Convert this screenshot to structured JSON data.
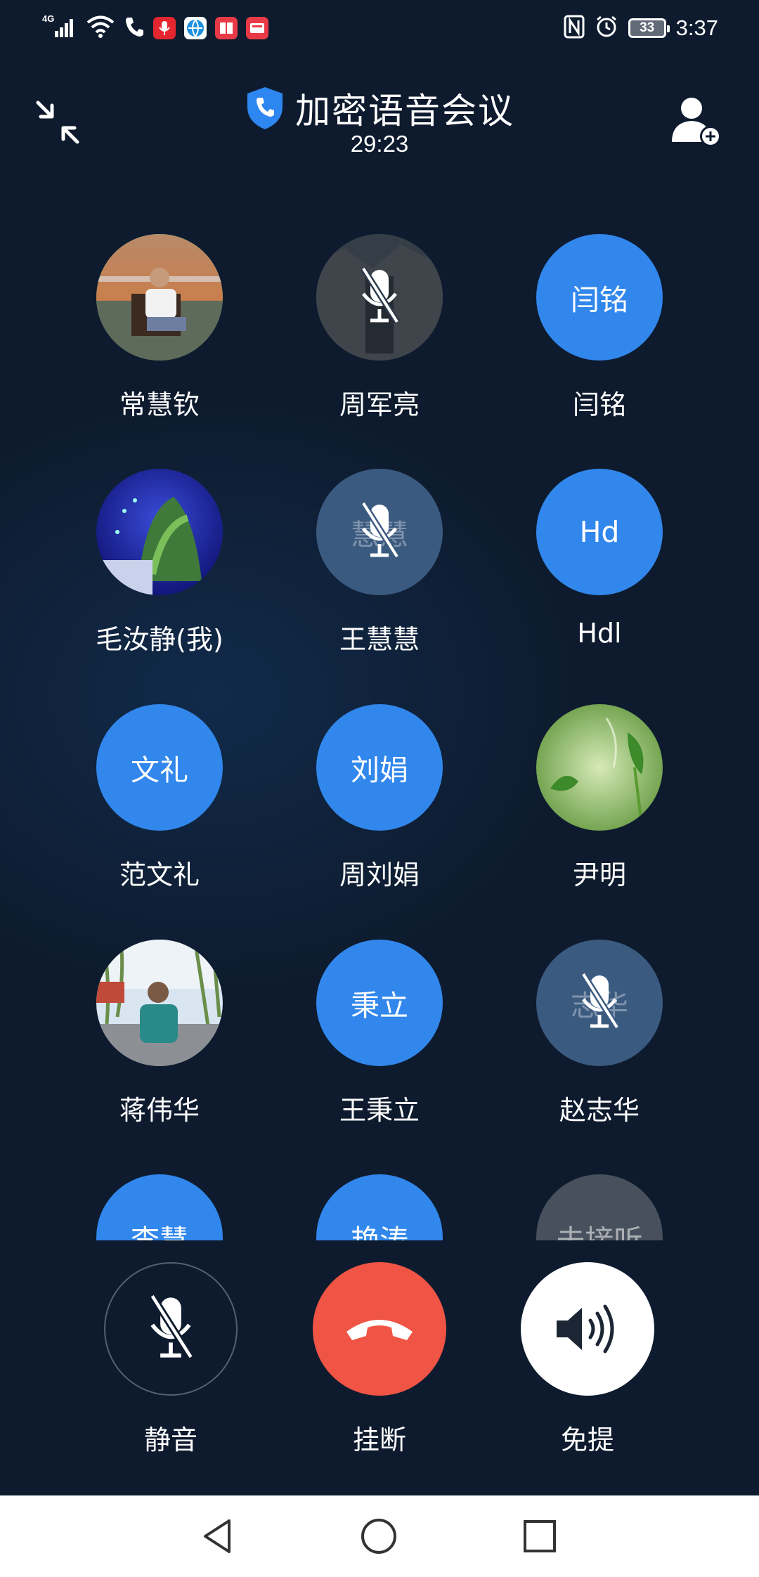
{
  "status_bar": {
    "network": "4G",
    "battery": "33",
    "time": "3:37"
  },
  "header": {
    "title": "加密语音会议",
    "timer": "29:23"
  },
  "participants": [
    {
      "name": "常慧钦",
      "avatar_type": "photo",
      "avatar_text": "",
      "muted": false
    },
    {
      "name": "周军亮",
      "avatar_type": "photo",
      "avatar_text": "",
      "muted": true
    },
    {
      "name": "闫铭",
      "avatar_type": "initials",
      "avatar_text": "闫铭",
      "muted": false
    },
    {
      "name": "毛汝静(我)",
      "avatar_type": "photo",
      "avatar_text": "",
      "muted": false
    },
    {
      "name": "王慧慧",
      "avatar_type": "initials",
      "avatar_text": "慧慧",
      "muted": true
    },
    {
      "name": "Hdl",
      "avatar_type": "initials",
      "avatar_text": "Hd",
      "muted": false
    },
    {
      "name": "范文礼",
      "avatar_type": "initials",
      "avatar_text": "文礼",
      "muted": false
    },
    {
      "name": "周刘娟",
      "avatar_type": "initials",
      "avatar_text": "刘娟",
      "muted": false
    },
    {
      "name": "尹明",
      "avatar_type": "photo",
      "avatar_text": "",
      "muted": false
    },
    {
      "name": "蒋伟华",
      "avatar_type": "photo",
      "avatar_text": "",
      "muted": false
    },
    {
      "name": "王秉立",
      "avatar_type": "initials",
      "avatar_text": "秉立",
      "muted": false
    },
    {
      "name": "赵志华",
      "avatar_type": "initials",
      "avatar_text": "志华",
      "muted": true
    },
    {
      "name": "",
      "avatar_type": "initials",
      "avatar_text": "李慧",
      "muted": false
    },
    {
      "name": "",
      "avatar_type": "initials",
      "avatar_text": "艳涛",
      "muted": false
    },
    {
      "name": "",
      "avatar_type": "status",
      "avatar_text": "未接听",
      "muted": false
    }
  ],
  "controls": {
    "mute_label": "静音",
    "hangup_label": "挂断",
    "speaker_label": "免提"
  },
  "colors": {
    "background": "#0e1b2e",
    "avatar_blue": "#3187ec",
    "hangup_red": "#ef5444",
    "shield_blue": "#2e86f0"
  },
  "icons": [
    "minimize-icon",
    "shield-phone-icon",
    "add-participant-icon",
    "mic-off-icon",
    "hangup-icon",
    "speaker-icon",
    "nav-back-icon",
    "nav-home-icon",
    "nav-recents-icon"
  ]
}
